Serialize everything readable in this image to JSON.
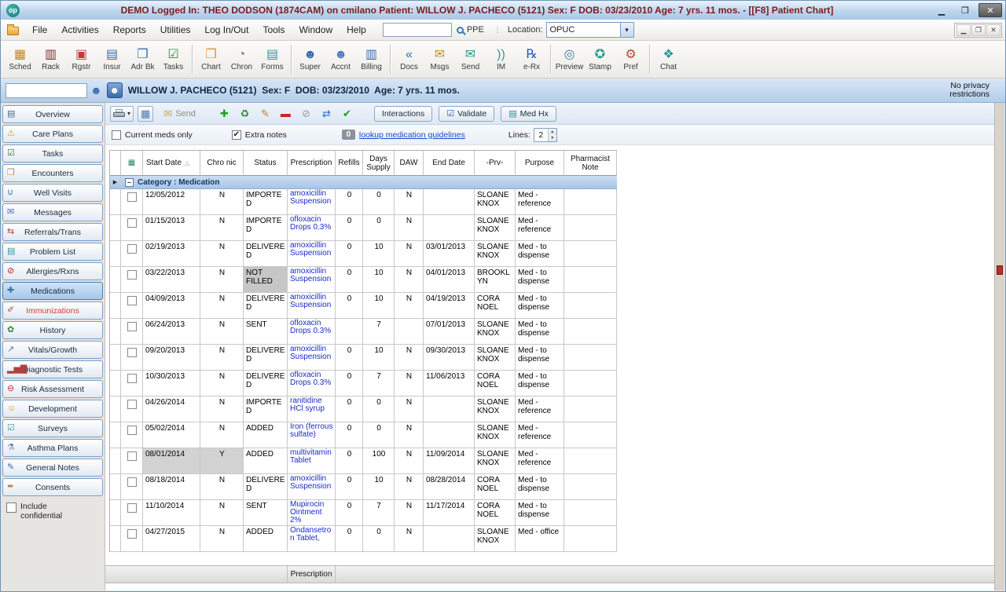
{
  "icons": {
    "minimize-icon": {
      "glyph": "▁",
      "color": "#222222"
    },
    "maximize-icon": {
      "glyph": "❐",
      "color": "#222222"
    },
    "close-icon": {
      "glyph": "✕",
      "color": "#ffffff"
    },
    "mdi-minimize-icon": {
      "glyph": "▁",
      "color": "#444444"
    },
    "mdi-restore-icon": {
      "glyph": "❐",
      "color": "#444444"
    },
    "mdi-close-icon": {
      "glyph": "✕",
      "color": "#444444"
    },
    "location-dropdown-icon": {
      "glyph": "▾",
      "color": "#10306a"
    },
    "sched-icon": {
      "glyph": "▦",
      "color": "#c5861f"
    },
    "rack-icon": {
      "glyph": "▥",
      "color": "#8a2a2a"
    },
    "register-icon": {
      "glyph": "▣",
      "color": "#c23b3b"
    },
    "insurance-icon": {
      "glyph": "▤",
      "color": "#3a6ab0"
    },
    "address-book-icon": {
      "glyph": "❒",
      "color": "#3a6ab0"
    },
    "tasks-icon": {
      "glyph": "☑",
      "color": "#2f8a3a"
    },
    "chart-icon": {
      "glyph": "❐",
      "color": "#d8952f"
    },
    "chron-icon": {
      "glyph": "◔",
      "color": "#8a7a5a"
    },
    "forms-icon": {
      "glyph": "▤",
      "color": "#2a9a9a"
    },
    "super-icon": {
      "glyph": "☻",
      "color": "#3a6ab0"
    },
    "accnt-icon": {
      "glyph": "☻",
      "color": "#4a7ac0"
    },
    "billing-icon": {
      "glyph": "▥",
      "color": "#3a6ab0"
    },
    "docs-icon": {
      "glyph": "«",
      "color": "#2a6ac0"
    },
    "msgs-icon": {
      "glyph": "✉",
      "color": "#c09030"
    },
    "send-nav-icon": {
      "glyph": "✉",
      "color": "#2a9a8a"
    },
    "im-icon": {
      "glyph": "))",
      "color": "#2a9a9a"
    },
    "erx-icon": {
      "glyph": "℞",
      "color": "#2a5ac0"
    },
    "preview-icon": {
      "glyph": "◎",
      "color": "#3a7ab0"
    },
    "stamp-icon": {
      "glyph": "✪",
      "color": "#2a9a8a"
    },
    "pref-icon": {
      "glyph": "⚙",
      "color": "#b05030"
    },
    "chat-icon": {
      "glyph": "❖",
      "color": "#2a9a9a"
    },
    "patient-lookup-icon": {
      "glyph": "☻",
      "color": "#3a6ab0"
    },
    "patient-avatar-icon": {
      "glyph": "☻",
      "color": "#ffffff"
    },
    "sb-overview-icon": {
      "glyph": "▤",
      "color": "#4a6a8a"
    },
    "sb-care-plans-icon": {
      "glyph": "⚠",
      "color": "#e0a020"
    },
    "sb-tasks-icon": {
      "glyph": "☑",
      "color": "#3a7a3a"
    },
    "sb-encounters-icon": {
      "glyph": "❒",
      "color": "#d08030"
    },
    "sb-well-visits-icon": {
      "glyph": "∪",
      "color": "#3a6ab0"
    },
    "sb-messages-icon": {
      "glyph": "✉",
      "color": "#3a6ab0"
    },
    "sb-referrals-icon": {
      "glyph": "⇆",
      "color": "#b04040"
    },
    "sb-problem-list-icon": {
      "glyph": "▤",
      "color": "#2a9a9a"
    },
    "sb-allergies-icon": {
      "glyph": "⊘",
      "color": "#c02020"
    },
    "sb-medications-icon": {
      "glyph": "✚",
      "color": "#2a7a9a"
    },
    "sb-immunizations-icon": {
      "glyph": "✐",
      "color": "#b05050"
    },
    "sb-history-icon": {
      "glyph": "✿",
      "color": "#3a8a3a"
    },
    "sb-vitals-icon": {
      "glyph": "↗",
      "color": "#6a7a8a"
    },
    "sb-diagnostics-icon": {
      "glyph": "▂▅▇",
      "color": "#b04040"
    },
    "sb-risk-icon": {
      "glyph": "⊖",
      "color": "#c03030"
    },
    "sb-development-icon": {
      "glyph": "☺",
      "color": "#e09030"
    },
    "sb-surveys-icon": {
      "glyph": "☑",
      "color": "#3a9a9a"
    },
    "sb-asthma-icon": {
      "glyph": "⚗",
      "color": "#6a8aa0"
    },
    "sb-notes-icon": {
      "glyph": "✎",
      "color": "#3a6ab0"
    },
    "sb-consents-icon": {
      "glyph": "✒",
      "color": "#b08030"
    },
    "print-dropdown-icon": {
      "glyph": "▾",
      "color": "#333333"
    },
    "grid-icon": {
      "glyph": "▦",
      "color": "#4a7ab0"
    },
    "send-icon": {
      "glyph": "✉",
      "color": "#c8aa50"
    },
    "add-icon": {
      "glyph": "✚",
      "color": "#1fa01f"
    },
    "renew-icon": {
      "glyph": "♻",
      "color": "#2a8a2a"
    },
    "edit-icon": {
      "glyph": "✎",
      "color": "#c08020"
    },
    "remove-icon": {
      "glyph": "▬",
      "color": "#cc2222"
    },
    "void-icon": {
      "glyph": "⊘",
      "color": "#9a9aa0"
    },
    "swap-icon": {
      "glyph": "⇄",
      "color": "#2a6ac8"
    },
    "confirm-icon": {
      "glyph": "✔",
      "color": "#189818"
    },
    "validate-icon": {
      "glyph": "☑",
      "color": "#2a5ac0"
    },
    "medhx-icon": {
      "glyph": "▤",
      "color": "#2a8a9a"
    },
    "meds-column-icon": {
      "glyph": "▦",
      "color": "#2a8a6a"
    },
    "sort-asc-icon": {
      "glyph": "△",
      "color": "#999999"
    },
    "row-marker-icon": {
      "glyph": "▶",
      "color": "#222222"
    },
    "collapse-icon": {
      "glyph": "–",
      "color": "#333333"
    },
    "spinner-up-icon": {
      "glyph": "▴",
      "color": "#444444"
    },
    "spinner-down-icon": {
      "glyph": "▾",
      "color": "#444444"
    }
  },
  "titlebar": {
    "logo": "op",
    "title": "DEMO Logged In: THEO DODSON (1874CAM) on cmilano  Patient: WILLOW J. PACHECO (5121)  Sex: F  DOB: 03/23/2010  Age: 7 yrs. 11 mos. - [[F8] Patient Chart]"
  },
  "menubar": {
    "items": [
      "File",
      "Activities",
      "Reports",
      "Utilities",
      "Log In/Out",
      "Tools",
      "Window",
      "Help"
    ],
    "search_value": "",
    "ppe_label": "PPE",
    "location_label": "Location:",
    "location_value": "OPUC"
  },
  "toolbar": {
    "groups": [
      {
        "items": [
          {
            "label": "Sched",
            "icon": "sched-icon"
          },
          {
            "label": "Rack",
            "icon": "rack-icon"
          },
          {
            "label": "Rgstr",
            "icon": "register-icon"
          },
          {
            "label": "Insur",
            "icon": "insurance-icon"
          },
          {
            "label": "Adr Bk",
            "icon": "address-book-icon"
          },
          {
            "label": "Tasks",
            "icon": "tasks-icon"
          }
        ]
      },
      {
        "items": [
          {
            "label": "Chart",
            "icon": "chart-icon"
          },
          {
            "label": "Chron",
            "icon": "chron-icon"
          },
          {
            "label": "Forms",
            "icon": "forms-icon"
          }
        ]
      },
      {
        "items": [
          {
            "label": "Super",
            "icon": "super-icon"
          },
          {
            "label": "Accnt",
            "icon": "accnt-icon"
          },
          {
            "label": "Billing",
            "icon": "billing-icon"
          }
        ]
      },
      {
        "items": [
          {
            "label": "Docs",
            "icon": "docs-icon"
          },
          {
            "label": "Msgs",
            "icon": "msgs-icon"
          },
          {
            "label": "Send",
            "icon": "send-nav-icon"
          },
          {
            "label": "IM",
            "icon": "im-icon"
          },
          {
            "label": "e-Rx",
            "icon": "erx-icon"
          }
        ]
      },
      {
        "items": [
          {
            "label": "Preview",
            "icon": "preview-icon"
          },
          {
            "label": "Stamp",
            "icon": "stamp-icon"
          },
          {
            "label": "Pref",
            "icon": "pref-icon"
          }
        ]
      },
      {
        "items": [
          {
            "label": "Chat",
            "icon": "chat-icon"
          }
        ]
      }
    ]
  },
  "patient_banner": {
    "search_value": "",
    "name_line": "WILLOW J. PACHECO (5121)  Sex: F  DOB: 03/23/2010  Age: 7 yrs. 11 mos.",
    "privacy_note": "No privacy restrictions"
  },
  "sidebar": {
    "items": [
      {
        "label": "Overview",
        "icon": "sb-overview-icon"
      },
      {
        "label": "Care Plans",
        "icon": "sb-care-plans-icon"
      },
      {
        "label": "Tasks",
        "icon": "sb-tasks-icon"
      },
      {
        "label": "Encounters",
        "icon": "sb-encounters-icon"
      },
      {
        "label": "Well Visits",
        "icon": "sb-well-visits-icon"
      },
      {
        "label": "Messages",
        "icon": "sb-messages-icon"
      },
      {
        "label": "Referrals/Trans",
        "icon": "sb-referrals-icon"
      },
      {
        "label": "Problem List",
        "icon": "sb-problem-list-icon"
      },
      {
        "label": "Allergies/Rxns",
        "icon": "sb-allergies-icon"
      },
      {
        "label": "Medications",
        "icon": "sb-medications-icon",
        "selected": true
      },
      {
        "label": "Immunizations",
        "icon": "sb-immunizations-icon",
        "accent": "#cc4433"
      },
      {
        "label": "History",
        "icon": "sb-history-icon"
      },
      {
        "label": "Vitals/Growth",
        "icon": "sb-vitals-icon"
      },
      {
        "label": "Diagnostic Tests",
        "icon": "sb-diagnostics-icon"
      },
      {
        "label": "Risk Assessment",
        "icon": "sb-risk-icon"
      },
      {
        "label": "Development",
        "icon": "sb-development-icon"
      },
      {
        "label": "Surveys",
        "icon": "sb-surveys-icon"
      },
      {
        "label": "Asthma Plans",
        "icon": "sb-asthma-icon"
      },
      {
        "label": "General Notes",
        "icon": "sb-notes-icon"
      },
      {
        "label": "Consents",
        "icon": "sb-consents-icon"
      }
    ],
    "include_confidential_label": "Include confidential",
    "include_confidential_checked": false
  },
  "med_panel": {
    "send_label": "Send",
    "interactions_label": "Interactions",
    "validate_label": "Validate",
    "medhx_label": "Med Hx",
    "current_meds_label": "Current meds only",
    "current_meds_checked": false,
    "extra_notes_label": "Extra notes",
    "extra_notes_checked": true,
    "guideline_badge": "0",
    "guideline_link": "lookup medication guidelines",
    "lines_label": "Lines:",
    "lines_value": "2"
  },
  "grid": {
    "columns": [
      {
        "key": "sel",
        "label": ""
      },
      {
        "key": "chk",
        "label": "",
        "icon": "meds-column-icon"
      },
      {
        "key": "start",
        "label": "Start Date",
        "sort": "asc"
      },
      {
        "key": "chronic",
        "label": "Chro nic"
      },
      {
        "key": "status",
        "label": "Status"
      },
      {
        "key": "rx",
        "label": "Prescription"
      },
      {
        "key": "refills",
        "label": "Refills"
      },
      {
        "key": "days",
        "label": "Days Supply"
      },
      {
        "key": "daw",
        "label": "DAW"
      },
      {
        "key": "end",
        "label": "End Date"
      },
      {
        "key": "prv",
        "label": "-Prv-"
      },
      {
        "key": "purpose",
        "label": "Purpose"
      },
      {
        "key": "note",
        "label": "Pharmacist Note"
      }
    ],
    "category_label": "Category : Medication",
    "footer_label": "Prescription",
    "rows": [
      {
        "start": "12/05/2012",
        "chronic": "N",
        "status": "IMPORTED",
        "rx": "amoxicillin Suspension",
        "refills": "0",
        "days": "0",
        "daw": "N",
        "end": "",
        "prv": "SLOANE KNOX",
        "purpose": "Med - reference",
        "note": ""
      },
      {
        "start": "01/15/2013",
        "chronic": "N",
        "status": "IMPORTED",
        "rx": "ofloxacin Drops 0.3%",
        "refills": "0",
        "days": "0",
        "daw": "N",
        "end": "",
        "prv": "SLOANE KNOX",
        "purpose": "Med - reference",
        "note": ""
      },
      {
        "start": "02/19/2013",
        "chronic": "N",
        "status": "DELIVERED",
        "rx": "amoxicillin Suspension",
        "refills": "0",
        "days": "10",
        "daw": "N",
        "end": "03/01/2013",
        "prv": "SLOANE KNOX",
        "purpose": "Med - to dispense",
        "note": ""
      },
      {
        "start": "03/22/2013",
        "chronic": "N",
        "status": "NOT FILLED",
        "rx": "amoxicillin Suspension",
        "refills": "0",
        "days": "10",
        "daw": "N",
        "end": "04/01/2013",
        "prv": "BROOKLYN",
        "purpose": "Med - to dispense",
        "note": "",
        "status_highlight": true
      },
      {
        "start": "04/09/2013",
        "chronic": "N",
        "status": "DELIVERED",
        "rx": "amoxicillin Suspension",
        "refills": "0",
        "days": "10",
        "daw": "N",
        "end": "04/19/2013",
        "prv": "CORA NOEL",
        "purpose": "Med - to dispense",
        "note": ""
      },
      {
        "start": "06/24/2013",
        "chronic": "N",
        "status": "SENT",
        "rx": "ofloxacin Drops 0.3%",
        "refills": "",
        "days": "7",
        "daw": "",
        "end": "07/01/2013",
        "prv": "SLOANE KNOX",
        "purpose": "Med - to dispense",
        "note": ""
      },
      {
        "start": "09/20/2013",
        "chronic": "N",
        "status": "DELIVERED",
        "rx": "amoxicillin Suspension",
        "refills": "0",
        "days": "10",
        "daw": "N",
        "end": "09/30/2013",
        "prv": "SLOANE KNOX",
        "purpose": "Med - to dispense",
        "note": ""
      },
      {
        "start": "10/30/2013",
        "chronic": "N",
        "status": "DELIVERED",
        "rx": "ofloxacin Drops 0.3%",
        "refills": "0",
        "days": "7",
        "daw": "N",
        "end": "11/06/2013",
        "prv": "CORA NOEL",
        "purpose": "Med - to dispense",
        "note": ""
      },
      {
        "start": "04/26/2014",
        "chronic": "N",
        "status": "IMPORTED",
        "rx": "ranitidine HCl syrup",
        "refills": "0",
        "days": "0",
        "daw": "N",
        "end": "",
        "prv": "SLOANE KNOX",
        "purpose": "Med - reference",
        "note": ""
      },
      {
        "start": "05/02/2014",
        "chronic": "N",
        "status": "ADDED",
        "rx": "Iron (ferrous sulfate)",
        "refills": "0",
        "days": "0",
        "daw": "N",
        "end": "",
        "prv": "SLOANE KNOX",
        "purpose": "Med - reference",
        "note": ""
      },
      {
        "start": "08/01/2014",
        "chronic": "Y",
        "status": "ADDED",
        "rx": "multivitamin Tablet",
        "refills": "0",
        "days": "100",
        "daw": "N",
        "end": "11/09/2014",
        "prv": "SLOANE KNOX",
        "purpose": "Med - reference",
        "note": "",
        "selected": true
      },
      {
        "start": "08/18/2014",
        "chronic": "N",
        "status": "DELIVERED",
        "rx": "amoxicillin Suspension",
        "refills": "0",
        "days": "10",
        "daw": "N",
        "end": "08/28/2014",
        "prv": "CORA NOEL",
        "purpose": "Med - to dispense",
        "note": ""
      },
      {
        "start": "11/10/2014",
        "chronic": "N",
        "status": "SENT",
        "rx": "Mupirocin Ointment 2%",
        "refills": "0",
        "days": "7",
        "daw": "N",
        "end": "11/17/2014",
        "prv": "CORA NOEL",
        "purpose": "Med - to dispense",
        "note": ""
      },
      {
        "start": "04/27/2015",
        "chronic": "N",
        "status": "ADDED",
        "rx": "Ondansetron Tablet,",
        "refills": "0",
        "days": "0",
        "daw": "N",
        "end": "",
        "prv": "SLOANE KNOX",
        "purpose": "Med - office",
        "note": ""
      }
    ]
  }
}
